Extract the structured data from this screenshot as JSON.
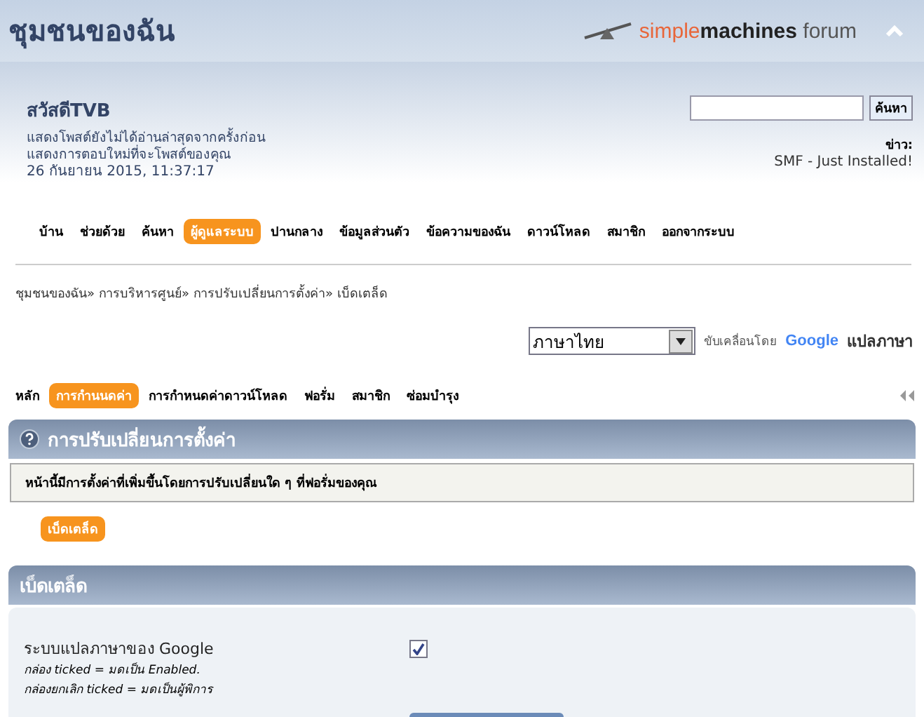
{
  "header": {
    "title": "ชุมชนของฉัน",
    "logo": {
      "brand_a": "simple",
      "brand_b": "machines",
      "brand_c": "forum"
    }
  },
  "user": {
    "greeting": "สวัสดีTVB",
    "links": [
      "แสดงโพสต์ยังไม่ได้อ่านล่าสุดจากครั้งก่อน",
      "แสดงการตอบใหม่ที่จะโพสต์ของคุณ"
    ],
    "date": "26 กันยายน 2015, 11:37:17"
  },
  "search": {
    "button": "ค้นหา"
  },
  "news": {
    "label": "ข่าว:",
    "text": "SMF - Just Installed!"
  },
  "menu": [
    {
      "label": "บ้าน",
      "selected": false
    },
    {
      "label": "ช่วยด้วย",
      "selected": false
    },
    {
      "label": "ค้นหา",
      "selected": false
    },
    {
      "label": "ผู้ดูแลระบบ",
      "selected": true
    },
    {
      "label": "ปานกลาง",
      "selected": false
    },
    {
      "label": "ข้อมูลส่วนตัว",
      "selected": false
    },
    {
      "label": "ข้อความของฉัน",
      "selected": false
    },
    {
      "label": "ดาวน์โหลด",
      "selected": false
    },
    {
      "label": "สมาชิก",
      "selected": false
    },
    {
      "label": "ออกจากระบบ",
      "selected": false
    }
  ],
  "breadcrumb": [
    "ชุมชนของฉัน»",
    "การบริหารศูนย์»",
    "การปรับเปลี่ยนการตั้งค่า»",
    "เบ็ดเตล็ด"
  ],
  "translate": {
    "language": "ภาษาไทย",
    "powered_by": "ขับเคลื่อนโดย",
    "google": "Google",
    "action": "แปลภาษา"
  },
  "admin_tabs": [
    {
      "label": "หลัก",
      "selected": false
    },
    {
      "label": "การกำนนดค่า",
      "selected": true
    },
    {
      "label": "การกำหนดค่าดาวน์โหลด",
      "selected": false
    },
    {
      "label": "ฟอรั่ม",
      "selected": false
    },
    {
      "label": "สมาชิก",
      "selected": false
    },
    {
      "label": "ซ่อมบำรุง",
      "selected": false
    }
  ],
  "section": {
    "title": "การปรับเปลี่ยนการตั้งค่า",
    "description": "หน้านี้มีการตั้งค่าที่เพิ่มขึ้นโดยการปรับเปลี่ยนใด ๆ ที่ฟอรั่มของคุณ",
    "subtabs": [
      {
        "label": "เบ็ดเตล็ด",
        "selected": true
      }
    ]
  },
  "panel": {
    "title": "เบ็ดเตล็ด",
    "settings": [
      {
        "label": "ระบบแปลภาษาของ Google",
        "notes": [
          "กล่อง ticked = มดเป็น Enabled.",
          "กล่องยกเลิก ticked = มดเป็นผู้พิการ"
        ],
        "checked": true
      }
    ]
  }
}
